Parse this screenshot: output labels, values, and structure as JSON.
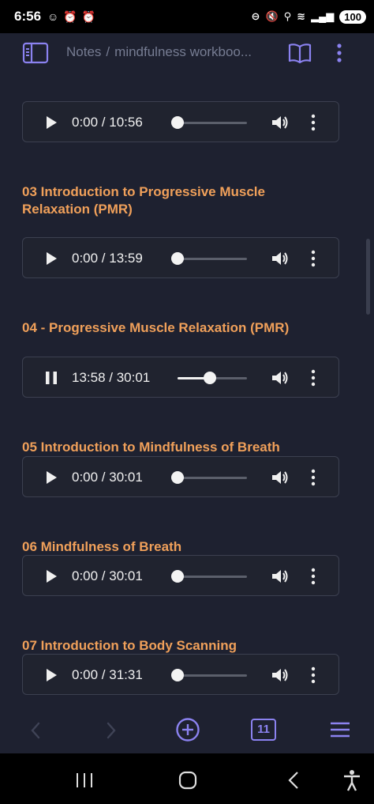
{
  "status_bar": {
    "time": "6:56",
    "battery": "100"
  },
  "breadcrumb": {
    "root": "Notes",
    "separator": "/",
    "current": "mindfulness workboo..."
  },
  "cut_heading": "‘",
  "tracks": [
    {
      "heading": "",
      "time": "0:00 / 10:56",
      "playing": false,
      "progress": 0
    },
    {
      "heading": "03 Introduction to Progressive Muscle Relaxation (PMR)",
      "time": "0:00 / 13:59",
      "playing": false,
      "progress": 0
    },
    {
      "heading": "04 - Progressive Muscle Relaxation (PMR)",
      "time": "13:58 / 30:01",
      "playing": true,
      "progress": 0.47
    },
    {
      "heading": "05 Introduction to Mindfulness of Breath",
      "time": "0:00 / 30:01",
      "playing": false,
      "progress": 0
    },
    {
      "heading": "06 Mindfulness of Breath",
      "time": "0:00 / 30:01",
      "playing": false,
      "progress": 0
    },
    {
      "heading": "07 Introduction to Body Scanning",
      "time": "0:00 / 31:31",
      "playing": false,
      "progress": 0
    }
  ],
  "toolbar": {
    "tab_count": "11"
  },
  "colors": {
    "accent": "#8b82f0",
    "heading": "#f0a05a",
    "background": "#1e2130"
  }
}
